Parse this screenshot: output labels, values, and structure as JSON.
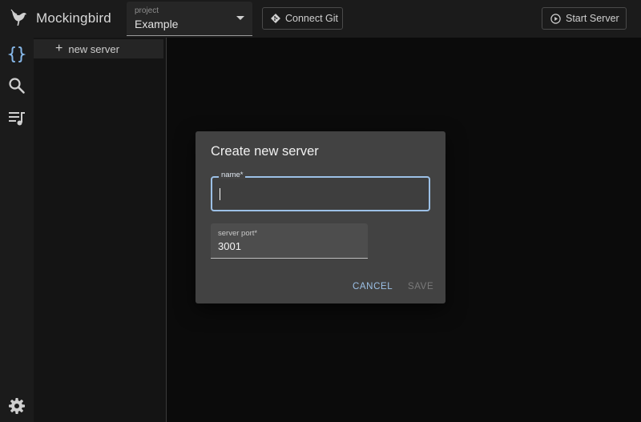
{
  "app": {
    "title": "Mockingbird",
    "logo_icon": "bird-icon"
  },
  "header": {
    "project": {
      "label": "project",
      "value": "Example"
    },
    "connect_git": {
      "label": "Connect Git",
      "icon": "git-icon"
    },
    "start_server": {
      "label": "Start Server",
      "icon": "play-circle-icon"
    }
  },
  "rail": {
    "items": [
      "braces-icon",
      "search-icon",
      "playlist-icon"
    ],
    "bottom": "gear-icon"
  },
  "server_list": {
    "new_server_label": "new server"
  },
  "dialog": {
    "title": "Create new server",
    "name_field": {
      "label": "name",
      "required": "*",
      "value": ""
    },
    "port_field": {
      "label": "server port",
      "required": "*",
      "value": "3001"
    },
    "cancel_label": "CANCEL",
    "save_label": "SAVE"
  },
  "colors": {
    "accent": "#9cc0e6",
    "background": "#0c0c0c",
    "surface": "#1b1b1b",
    "dialog": "#424242"
  }
}
